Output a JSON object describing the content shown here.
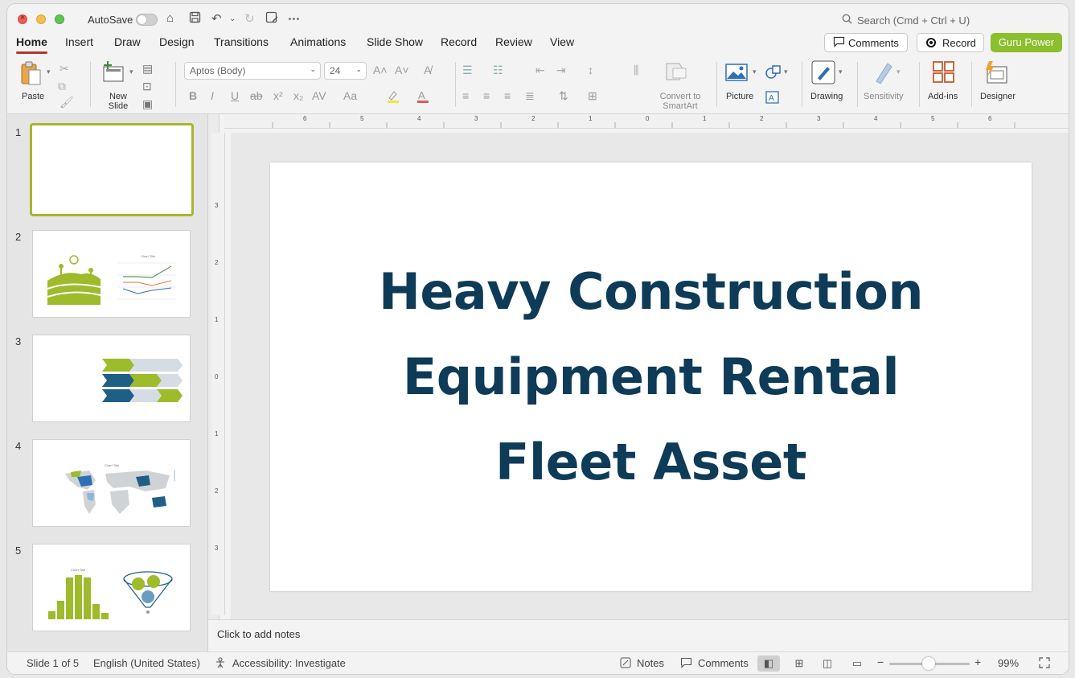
{
  "titlebar": {
    "autosave_label": "AutoSave",
    "search_placeholder": "Search (Cmd + Ctrl + U)"
  },
  "tabs": [
    "Home",
    "Insert",
    "Draw",
    "Design",
    "Transitions",
    "Animations",
    "Slide Show",
    "Record",
    "Review",
    "View"
  ],
  "active_tab": "Home",
  "header_buttons": {
    "comments": "Comments",
    "record": "Record",
    "guru": "Guru Power"
  },
  "ribbon": {
    "paste": "Paste",
    "new_slide": "New Slide",
    "font_name": "Aptos (Body)",
    "font_size": "24",
    "convert_smartart": "Convert to SmartArt",
    "picture": "Picture",
    "drawing": "Drawing",
    "sensitivity": "Sensitivity",
    "addins": "Add-ins",
    "designer": "Designer"
  },
  "slides": [
    {
      "number": "1"
    },
    {
      "number": "2"
    },
    {
      "number": "3"
    },
    {
      "number": "4"
    },
    {
      "number": "5"
    }
  ],
  "thumb_text": {
    "chart_title": "Chart Title"
  },
  "slide": {
    "title_line1": "Heavy Construction",
    "title_line2": "Equipment Rental",
    "title_line3": "Fleet Asset"
  },
  "ruler": {
    "h_labels": [
      "6",
      "5",
      "4",
      "3",
      "2",
      "1",
      "0",
      "1",
      "2",
      "3",
      "4",
      "5",
      "6"
    ],
    "v_labels": [
      "3",
      "2",
      "1",
      "0",
      "1",
      "2",
      "3"
    ]
  },
  "notes_placeholder": "Click to add notes",
  "status": {
    "slide_of": "Slide 1 of 5",
    "language": "English (United States)",
    "accessibility": "Accessibility: Investigate",
    "notes": "Notes",
    "comments": "Comments",
    "zoom": "99%"
  },
  "colors": {
    "accent_green": "#8bbf2c",
    "title_navy": "#0e3b57",
    "selection_border": "#a8b62e",
    "tab_underline": "#b5372d"
  }
}
